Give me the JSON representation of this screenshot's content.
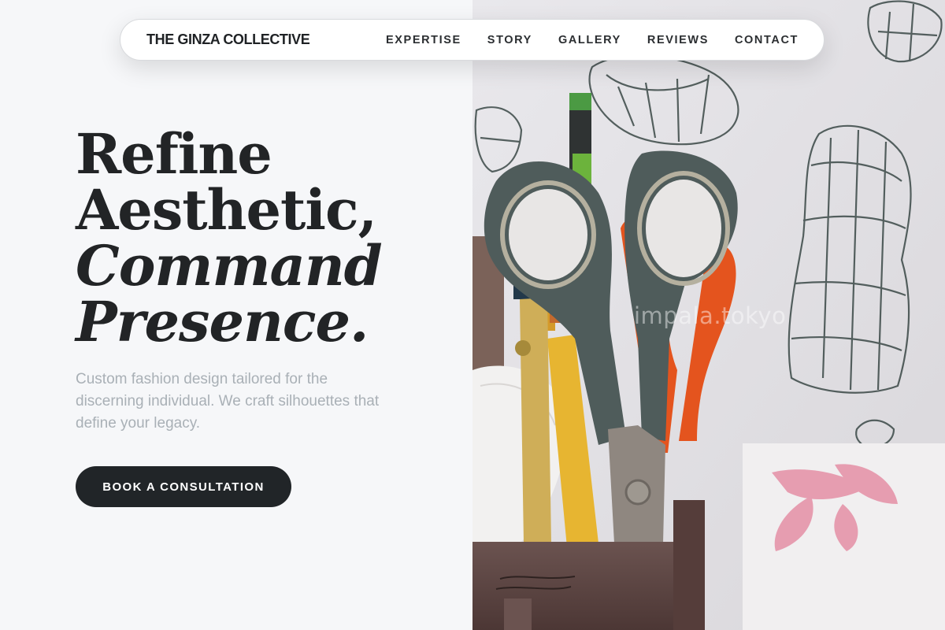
{
  "nav": {
    "brand": "THE GINZA COLLECTIVE",
    "links": [
      "EXPERTISE",
      "STORY",
      "GALLERY",
      "REVIEWS",
      "CONTACT"
    ]
  },
  "hero": {
    "headline": [
      "Refine",
      "Aesthetic,",
      "Command",
      "Presence."
    ],
    "lead": "Custom fashion design tailored for the discerning individual. We craft silhouettes that define your legacy.",
    "cta_label": "BOOK A CONSULTATION"
  },
  "photo": {
    "alt": "Pot of scissors and pencils in front of fashion sketches",
    "watermark": "impala.tokyo"
  },
  "colors": {
    "background": "#f6f7f9",
    "text": "#212427",
    "muted": "#a9b0b6",
    "button": "#212528",
    "scissor_grey": "#4f5c5b",
    "scissor_orange": "#e4541e"
  }
}
